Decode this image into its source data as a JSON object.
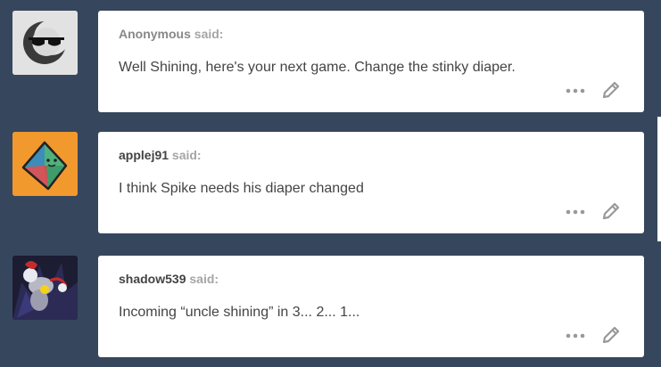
{
  "posts": [
    {
      "user": "Anonymous",
      "said": "said:",
      "message": "Well Shining, here's your next game. Change the stinky diaper.",
      "avatar_icon": "sunglasses-moon-avatar",
      "more_icon": "more-dots-icon",
      "edit_icon": "pencil-icon"
    },
    {
      "user": "applej91",
      "said": "said:",
      "message": "I think Spike needs his diaper changed",
      "avatar_icon": "colored-diamond-avatar",
      "more_icon": "more-dots-icon",
      "edit_icon": "pencil-icon"
    },
    {
      "user": "shadow539",
      "said": "said:",
      "message": "Incoming “uncle shining” in 3... 2... 1...",
      "avatar_icon": "character-art-avatar",
      "more_icon": "more-dots-icon",
      "edit_icon": "pencil-icon"
    }
  ],
  "colors": {
    "page_background": "#36465d",
    "card_background": "#ffffff",
    "username": "#444444",
    "anonymous_username": "#888888",
    "said_label": "#a5a5a5",
    "message_text": "#444444",
    "icon_gray": "#999999",
    "avatar_orange": "#f2992e"
  }
}
